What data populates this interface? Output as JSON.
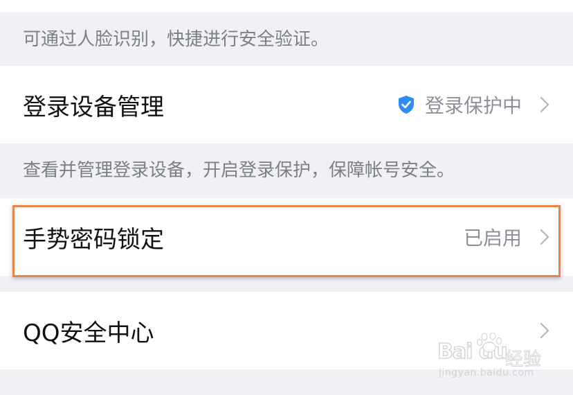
{
  "face_desc": "可通过人脸识别，快捷进行安全验证。",
  "login_device": {
    "title": "登录设备管理",
    "status": "登录保护中",
    "status_icon": "shield-check-icon",
    "accent_color": "#2f8cf3"
  },
  "login_desc": "查看并管理登录设备，开启登录保护，保障帐号安全。",
  "gesture_lock": {
    "title": "手势密码锁定",
    "status": "已启用",
    "highlight_color": "#e8834a"
  },
  "qq_security": {
    "title": "QQ安全中心"
  },
  "watermark": {
    "logo": "Bai du",
    "text": "经验",
    "url": "jingyan.baidu.com"
  }
}
